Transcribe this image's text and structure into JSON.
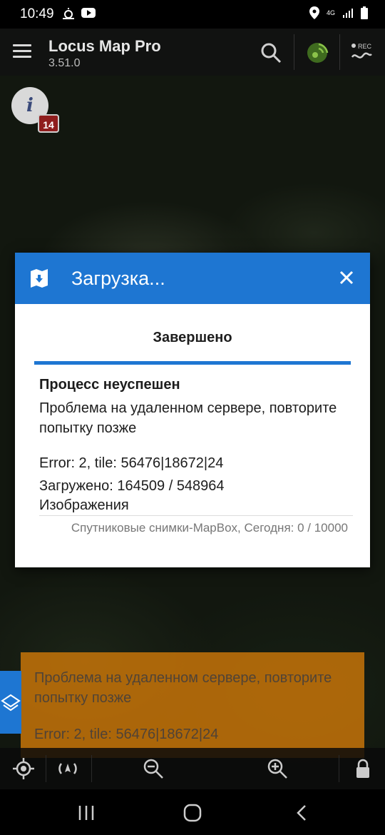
{
  "status_bar": {
    "time": "10:49",
    "network": "4G",
    "icons": [
      "weather-icon",
      "youtube-icon",
      "location-icon",
      "signal-icon",
      "battery-icon"
    ]
  },
  "app_bar": {
    "title": "Locus Map Pro",
    "version": "3.51.0",
    "icons": [
      "menu-icon",
      "search-icon",
      "gps-icon",
      "rec-icon"
    ],
    "rec_label": "REC"
  },
  "map": {
    "info_badge": "14",
    "info_glyph": "i"
  },
  "dialog": {
    "title": "Загрузка...",
    "status": "Завершено",
    "progress": 1.0,
    "heading": "Процесс неуспешен",
    "message": "Проблема на удаленном сервере, повторите попытку позже",
    "error_line": "Error: 2, tile: 56476|18672|24",
    "loaded_line": "Загружено: 164509 / 548964",
    "images_label": "Изображения",
    "footer": "Спутниковые снимки-MapBox, Сегодня: 0 / 10000",
    "accent_color": "#1e76d2"
  },
  "toast": {
    "message": "Проблема на удаленном сервере, повторите попытку позже",
    "error": "Error: 2, tile: 56476|18672|24",
    "color": "#cd7808"
  },
  "bottom_bar": {
    "icons": [
      "my-location-icon",
      "rotate-icon",
      "zoom-out-icon",
      "zoom-in-icon",
      "lock-icon"
    ]
  },
  "nav_bar": {
    "icons": [
      "recent-apps-icon",
      "home-icon",
      "back-icon"
    ]
  }
}
